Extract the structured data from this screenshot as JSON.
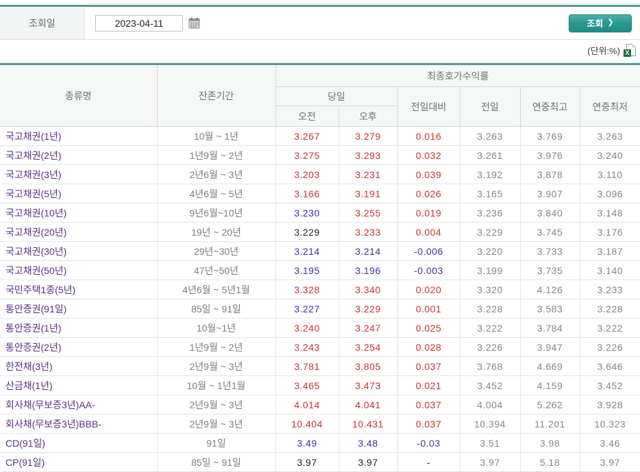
{
  "query": {
    "label": "조회일",
    "date_value": "2023-04-11",
    "calendar_icon": "calendar-icon",
    "button_label": "조회",
    "button_arrow": "❯"
  },
  "unit_label": "(단위:%)",
  "excel_icon": "excel-download-icon",
  "colors": {
    "teal_accent": "#4f9b94",
    "up": "#c53131",
    "down": "#3434a4",
    "flat": "#1f1f1f",
    "name_purple": "#5a2e86",
    "header_bg": "#f5f7f6",
    "header_fg": "#657571",
    "label_bg": "#f1f5f4",
    "label_fg": "#5f706d"
  },
  "table": {
    "header": {
      "col_type": "종류명",
      "col_period": "잔존기간",
      "group_yield": "최종호가수익률",
      "group_today": "당일",
      "col_am": "오전",
      "col_pm": "오후",
      "col_change": "전일대비",
      "col_prev": "전일",
      "col_high": "연중최고",
      "col_low": "연중최저"
    },
    "rows": [
      {
        "name": "국고채권(1년)",
        "period": "10월 ~ 1년",
        "am": "3.267",
        "am_c": "up",
        "pm": "3.279",
        "pm_c": "up",
        "chg": "0.016",
        "chg_c": "up",
        "prev": "3.263",
        "high": "3.769",
        "low": "3.263"
      },
      {
        "name": "국고채권(2년)",
        "period": "1년9월 ~ 2년",
        "am": "3.275",
        "am_c": "up",
        "pm": "3.293",
        "pm_c": "up",
        "chg": "0.032",
        "chg_c": "up",
        "prev": "3.261",
        "high": "3.976",
        "low": "3.240"
      },
      {
        "name": "국고채권(3년)",
        "period": "2년6월 ~ 3년",
        "am": "3.203",
        "am_c": "up",
        "pm": "3.231",
        "pm_c": "up",
        "chg": "0.039",
        "chg_c": "up",
        "prev": "3.192",
        "high": "3.878",
        "low": "3.110"
      },
      {
        "name": "국고채권(5년)",
        "period": "4년6월 ~ 5년",
        "am": "3.166",
        "am_c": "up",
        "pm": "3.191",
        "pm_c": "up",
        "chg": "0.026",
        "chg_c": "up",
        "prev": "3.165",
        "high": "3.907",
        "low": "3.096"
      },
      {
        "name": "국고채권(10년)",
        "period": "9년6월~10년",
        "am": "3.230",
        "am_c": "down",
        "pm": "3.255",
        "pm_c": "up",
        "chg": "0.019",
        "chg_c": "up",
        "prev": "3.236",
        "high": "3.840",
        "low": "3.148"
      },
      {
        "name": "국고채권(20년)",
        "period": "19년 ~ 20년",
        "am": "3.229",
        "am_c": "flat",
        "pm": "3.233",
        "pm_c": "up",
        "chg": "0.004",
        "chg_c": "up",
        "prev": "3.229",
        "high": "3.745",
        "low": "3.176"
      },
      {
        "name": "국고채권(30년)",
        "period": "29년~30년",
        "am": "3.214",
        "am_c": "down",
        "pm": "3.214",
        "pm_c": "down",
        "chg": "-0.006",
        "chg_c": "down",
        "prev": "3.220",
        "high": "3.733",
        "low": "3.187"
      },
      {
        "name": "국고채권(50년)",
        "period": "47년~50년",
        "am": "3.195",
        "am_c": "down",
        "pm": "3.196",
        "pm_c": "down",
        "chg": "-0.003",
        "chg_c": "down",
        "prev": "3.199",
        "high": "3.735",
        "low": "3.140"
      },
      {
        "name": "국민주택1종(5년)",
        "period": "4년6월 ~ 5년1월",
        "am": "3.328",
        "am_c": "up",
        "pm": "3.340",
        "pm_c": "up",
        "chg": "0.020",
        "chg_c": "up",
        "prev": "3.320",
        "high": "4.126",
        "low": "3.233"
      },
      {
        "name": "통안증권(91일)",
        "period": "85일 ~ 91일",
        "am": "3.227",
        "am_c": "down",
        "pm": "3.229",
        "pm_c": "up",
        "chg": "0.001",
        "chg_c": "up",
        "prev": "3.228",
        "high": "3.583",
        "low": "3.228"
      },
      {
        "name": "통안증권(1년)",
        "period": "10월~1년",
        "am": "3.240",
        "am_c": "up",
        "pm": "3.247",
        "pm_c": "up",
        "chg": "0.025",
        "chg_c": "up",
        "prev": "3.222",
        "high": "3.784",
        "low": "3.222"
      },
      {
        "name": "통안증권(2년)",
        "period": "1년9월 ~ 2년",
        "am": "3.243",
        "am_c": "up",
        "pm": "3.254",
        "pm_c": "up",
        "chg": "0.028",
        "chg_c": "up",
        "prev": "3.226",
        "high": "3.947",
        "low": "3.226"
      },
      {
        "name": "한전채(3년)",
        "period": "2년9월 ~ 3년",
        "am": "3.781",
        "am_c": "up",
        "pm": "3.805",
        "pm_c": "up",
        "chg": "0.037",
        "chg_c": "up",
        "prev": "3.768",
        "high": "4.669",
        "low": "3.646"
      },
      {
        "name": "산금채(1년)",
        "period": "10월 ~ 1년1월",
        "am": "3.465",
        "am_c": "up",
        "pm": "3.473",
        "pm_c": "up",
        "chg": "0.021",
        "chg_c": "up",
        "prev": "3.452",
        "high": "4.159",
        "low": "3.452"
      },
      {
        "name": "회사채(무보증3년)AA-",
        "period": "2년9월 ~ 3년",
        "am": "4.014",
        "am_c": "up",
        "pm": "4.041",
        "pm_c": "up",
        "chg": "0.037",
        "chg_c": "up",
        "prev": "4.004",
        "high": "5.262",
        "low": "3.928"
      },
      {
        "name": "회사채(무보증3년)BBB-",
        "period": "2년9월 ~ 3년",
        "am": "10.404",
        "am_c": "up",
        "pm": "10.431",
        "pm_c": "up",
        "chg": "0.037",
        "chg_c": "up",
        "prev": "10.394",
        "high": "11.201",
        "low": "10.323"
      },
      {
        "name": "CD(91일)",
        "period": "91일",
        "am": "3.49",
        "am_c": "down",
        "pm": "3.48",
        "pm_c": "down",
        "chg": "-0.03",
        "chg_c": "down",
        "prev": "3.51",
        "high": "3.98",
        "low": "3.46"
      },
      {
        "name": "CP(91일)",
        "period": "85일 ~ 91일",
        "am": "3.97",
        "am_c": "flat",
        "pm": "3.97",
        "pm_c": "flat",
        "chg": "-",
        "chg_c": "flat",
        "prev": "3.97",
        "high": "5.18",
        "low": "3.97"
      }
    ]
  }
}
